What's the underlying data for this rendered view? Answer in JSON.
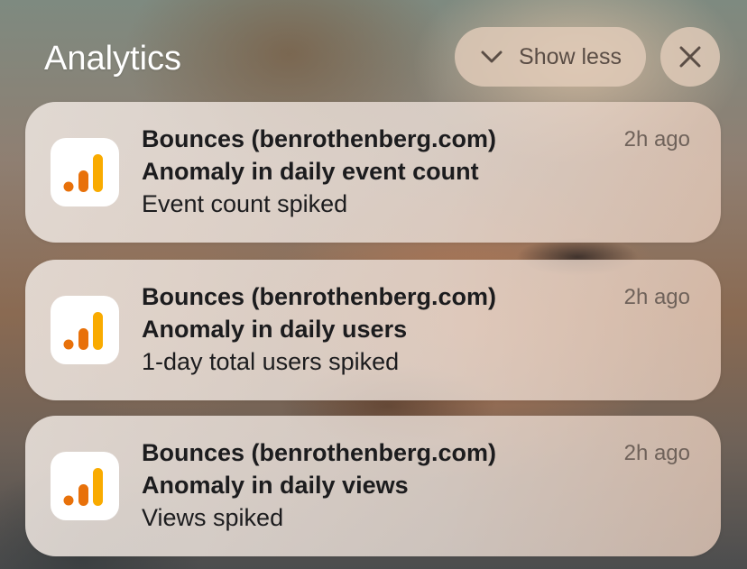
{
  "header": {
    "title": "Analytics",
    "show_less_label": "Show less",
    "show_less_icon": "chevron-down-icon",
    "close_icon": "close-icon"
  },
  "colors": {
    "icon_bar_dark": "#E8710A",
    "icon_bar_light": "#F9AB00"
  },
  "notifications": [
    {
      "icon": "google-analytics-icon",
      "app": "Bounces (benrothenberg.com)",
      "time": "2h ago",
      "title": "Anomaly in daily event count",
      "body": "Event count spiked"
    },
    {
      "icon": "google-analytics-icon",
      "app": "Bounces (benrothenberg.com)",
      "time": "2h ago",
      "title": "Anomaly in daily users",
      "body": "1-day total users spiked"
    },
    {
      "icon": "google-analytics-icon",
      "app": "Bounces (benrothenberg.com)",
      "time": "2h ago",
      "title": "Anomaly in daily views",
      "body": "Views spiked"
    }
  ]
}
